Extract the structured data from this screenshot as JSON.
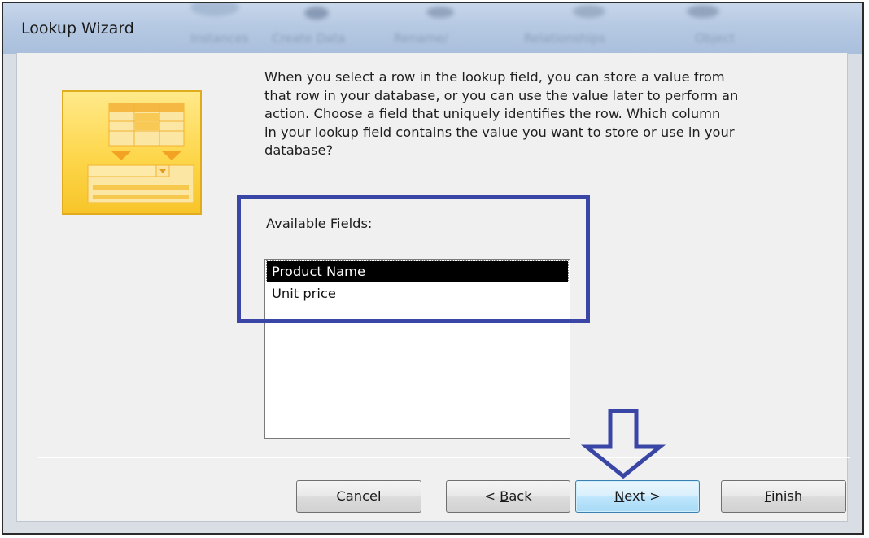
{
  "window": {
    "title": "Lookup Wizard",
    "background_ribbon_blur": [
      "Instances",
      "Create Data",
      "Rename/",
      "Relationships",
      "Object"
    ]
  },
  "instructions": "When you select a row in the lookup field, you can store a value from\nthat row in your database, or you can use the value later to perform an\naction.  Choose a field that uniquely identifies the row. Which column\nin your lookup field contains the value you want to store or use in your\ndatabase?",
  "available_fields": {
    "label": "Available Fields:",
    "items": [
      {
        "label": "Product Name",
        "selected": true
      },
      {
        "label": "Unit price",
        "selected": false
      }
    ]
  },
  "buttons": {
    "cancel": {
      "label": "Cancel"
    },
    "back": {
      "prefix": "< ",
      "mnemonic": "B",
      "rest": "ack"
    },
    "next": {
      "mnemonic": "N",
      "rest": "ext >",
      "default": true
    },
    "finish": {
      "mnemonic": "F",
      "rest": "inish"
    }
  },
  "annotations": {
    "highlight_color": "#3a46a6",
    "arrow_color": "#3a46a6"
  },
  "colors": {
    "wizard_image": "#fdd64a",
    "selection": "#000000",
    "dialog_bg": "#f0f0f0"
  }
}
